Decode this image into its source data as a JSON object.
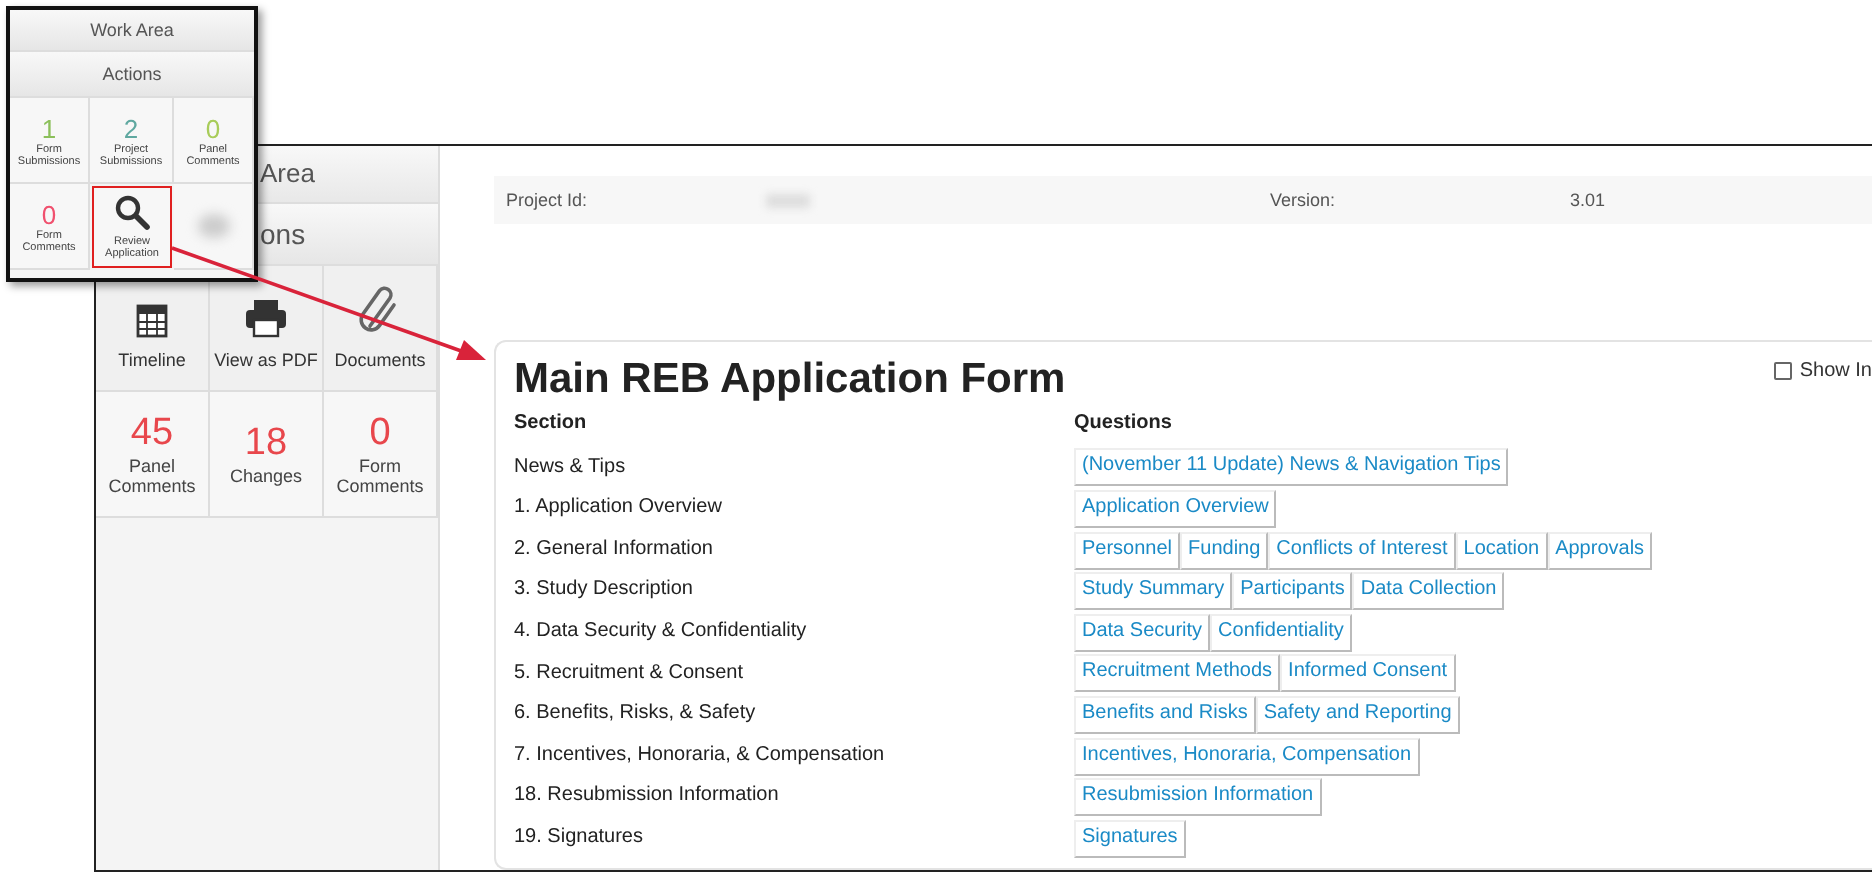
{
  "popup": {
    "title": "Work Area",
    "subtitle": "Actions",
    "tiles": [
      {
        "kind": "count",
        "value": "1",
        "label": "Form Submissions",
        "color": "#8bbf5a"
      },
      {
        "kind": "count",
        "value": "2",
        "label": "Project Submissions",
        "color": "#5fa8a0"
      },
      {
        "kind": "count",
        "value": "0",
        "label": "Panel Comments",
        "color": "#a8cc5a"
      },
      {
        "kind": "count",
        "value": "0",
        "label": "Form Comments",
        "color": "#f0506e"
      },
      {
        "kind": "action",
        "label": "Review Application",
        "highlighted": true
      }
    ]
  },
  "sidebar": {
    "title": "Area",
    "subtitle": "ons",
    "actions": [
      {
        "label": "Timeline"
      },
      {
        "label": "View as PDF"
      },
      {
        "label": "Documents"
      }
    ],
    "counts": [
      {
        "value": "45",
        "label": "Panel Comments"
      },
      {
        "value": "18",
        "label": "Changes"
      },
      {
        "value": "0",
        "label": "Form Comments"
      }
    ]
  },
  "info": {
    "project_id_label": "Project Id:",
    "version_label": "Version:",
    "version": "3.01"
  },
  "form": {
    "title": "Main REB Application Form",
    "show_toggle": {
      "label": "Show In",
      "checked": false
    },
    "columns": [
      "Section",
      "Questions"
    ],
    "rows": [
      {
        "section": "News & Tips",
        "questions": [
          "(November 11 Update) News & Navigation Tips"
        ]
      },
      {
        "section": "1. Application Overview",
        "questions": [
          "Application Overview"
        ]
      },
      {
        "section": "2. General Information",
        "questions": [
          "Personnel",
          "Funding",
          "Conflicts of Interest",
          "Location",
          "Approvals"
        ]
      },
      {
        "section": "3. Study Description",
        "questions": [
          "Study Summary",
          "Participants",
          "Data Collection"
        ]
      },
      {
        "section": "4. Data Security & Confidentiality",
        "questions": [
          "Data Security",
          "Confidentiality"
        ]
      },
      {
        "section": "5. Recruitment & Consent",
        "questions": [
          "Recruitment Methods",
          "Informed Consent"
        ]
      },
      {
        "section": "6. Benefits, Risks, & Safety",
        "questions": [
          "Benefits and Risks",
          "Safety and Reporting"
        ]
      },
      {
        "section": "7. Incentives, Honoraria, & Compensation",
        "questions": [
          "Incentives, Honoraria, Compensation"
        ]
      },
      {
        "section": "18. Resubmission Information",
        "questions": [
          "Resubmission Information"
        ]
      },
      {
        "section": "19. Signatures",
        "questions": [
          "Signatures"
        ]
      }
    ]
  }
}
